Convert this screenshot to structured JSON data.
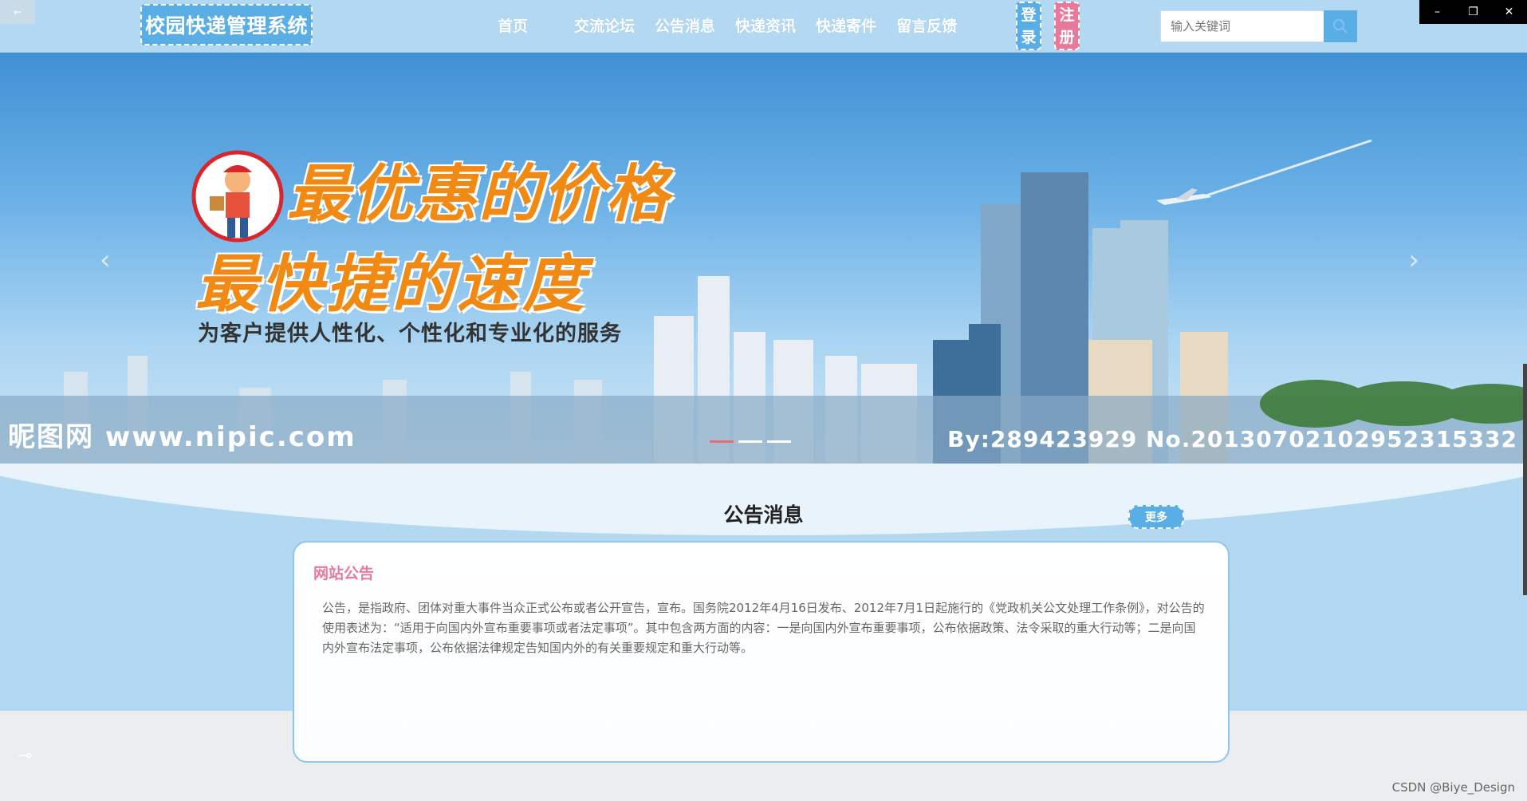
{
  "window": {
    "back_label": "←",
    "minimize": "–",
    "restore": "❐",
    "close": "✕"
  },
  "header": {
    "logo": "校园快递管理系统",
    "nav": [
      "首页",
      "交流论坛",
      "公告消息",
      "快递资讯",
      "快递寄件",
      "留言反馈"
    ],
    "login": [
      "登",
      "录"
    ],
    "register": [
      "注",
      "册"
    ],
    "search_placeholder": "输入关键词"
  },
  "banner": {
    "headline_1": "最优惠的价格",
    "headline_2": "最快捷的速度",
    "subtitle": "为客户提供人性化、个性化和专业化的服务",
    "watermark_left": "昵图网 www.nipic.com",
    "watermark_right": "By:289423929 No.20130702102952315332",
    "prev": "‹",
    "next": "›"
  },
  "notice": {
    "section_title": "公告消息",
    "more": "更多",
    "card_title": "网站公告",
    "card_body": "公告，是指政府、团体对重大事件当众正式公布或者公开宣告，宣布。国务院2012年4月16日发布、2012年7月1日起施行的《党政机关公文处理工作条例》，对公告的使用表述为：“适用于向国内外宣布重要事项或者法定事项”。其中包含两方面的内容：一是向国内外宣布重要事项，公布依据政策、法令采取的重大行动等；二是向国内外宣布法定事项，公布依据法律规定告知国内外的有关重要规定和重大行动等。"
  },
  "footer": {
    "csdn": "CSDN @Biye_Design"
  },
  "colors": {
    "header_bg": "#b3d9f2",
    "accent_blue": "#5aaee6",
    "accent_pink": "#e8799b",
    "headline_orange": "#f08a14"
  }
}
